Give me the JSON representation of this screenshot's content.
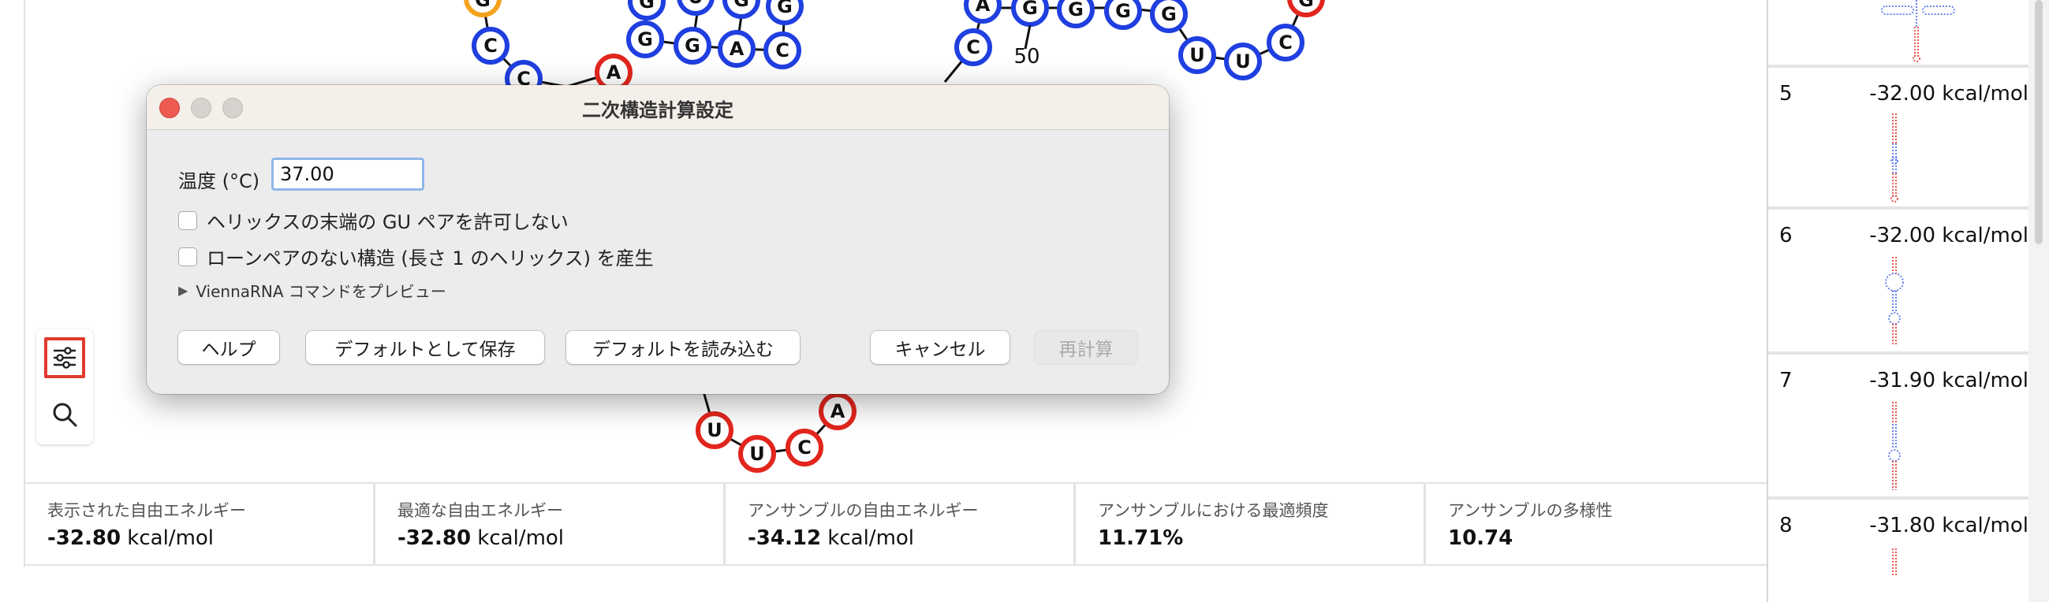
{
  "dialog": {
    "title": "二次構造計算設定",
    "temperature_label": "温度 (°C)",
    "temperature_value": "37.00",
    "options": [
      {
        "label": "ヘリックスの末端の GU ペアを許可しない",
        "checked": false
      },
      {
        "label": "ローンペアのない構造 (長さ 1 のヘリックス) を産生",
        "checked": false
      }
    ],
    "preview_label": "ViennaRNA コマンドをプレビュー",
    "buttons": {
      "help": "ヘルプ",
      "save_default": "デフォルトとして保存",
      "load_default": "デフォルトを読み込む",
      "cancel": "キャンセル",
      "recalculate": "再計算"
    }
  },
  "stats": [
    {
      "label": "表示された自由エネルギー",
      "value": "-32.80",
      "unit": "kcal/mol"
    },
    {
      "label": "最適な自由エネルギー",
      "value": "-32.80",
      "unit": "kcal/mol"
    },
    {
      "label": "アンサンブルの自由エネルギー",
      "value": "-34.12",
      "unit": "kcal/mol"
    },
    {
      "label": "アンサンブルにおける最適頻度",
      "value": "11.71%",
      "unit": ""
    },
    {
      "label": "アンサンブルの多様性",
      "value": "10.74",
      "unit": ""
    }
  ],
  "alternatives": [
    {
      "index": "5",
      "energy": "-32.00 kcal/mol"
    },
    {
      "index": "6",
      "energy": "-32.00 kcal/mol"
    },
    {
      "index": "7",
      "energy": "-31.90 kcal/mol"
    },
    {
      "index": "8",
      "energy": "-31.80 kcal/mol"
    }
  ],
  "structure": {
    "position_label": "50",
    "nucleotides": [
      "G",
      "C",
      "C",
      "A",
      "G",
      "G",
      "A",
      "C",
      "G",
      "G",
      "U",
      "G",
      "A",
      "C",
      "A",
      "G",
      "G",
      "G",
      "G",
      "U",
      "U",
      "C",
      "G",
      "U",
      "U",
      "C",
      "A",
      "A"
    ]
  },
  "colors": {
    "paired": "#1f3fe0",
    "unpaired": "#e2261d",
    "terminal": "#f4a21d",
    "highlight": "#e13a2e"
  },
  "tools": {
    "settings_icon": "sliders-icon",
    "search_icon": "search-icon"
  }
}
